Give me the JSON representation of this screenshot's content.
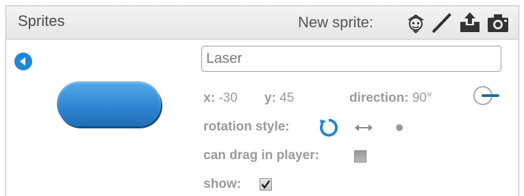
{
  "panel": {
    "title": "Sprites",
    "new_sprite_label": "New sprite:",
    "new_sprite_icons": [
      "sprite-library-icon",
      "paint-brush-icon",
      "upload-icon",
      "camera-icon"
    ]
  },
  "sprite": {
    "name": "Laser",
    "x_label": "x:",
    "x_value": "-30",
    "y_label": "y:",
    "y_value": "45",
    "direction_label": "direction:",
    "direction_value": "90°"
  },
  "rotation": {
    "label": "rotation style:",
    "options": [
      "all-around",
      "left-right",
      "don't rotate"
    ],
    "selected": "all-around"
  },
  "drag": {
    "label": "can drag in player:",
    "checked": false
  },
  "show": {
    "label": "show:",
    "checked": true
  },
  "colors": {
    "accent": "#1e88d6",
    "sprite_fill": "#2f87d3",
    "label_gray": "#9a9a9a"
  }
}
